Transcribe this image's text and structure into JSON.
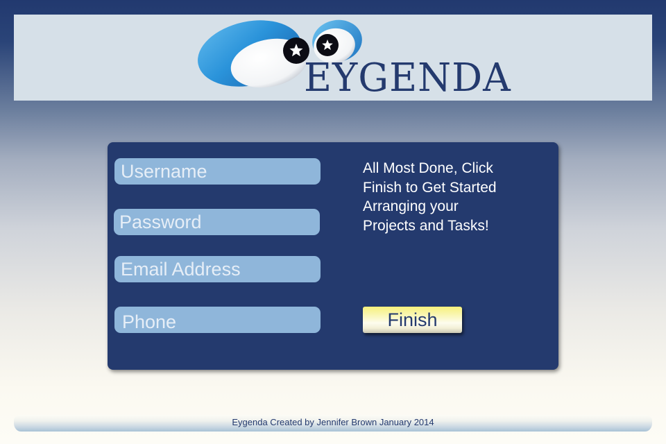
{
  "header": {
    "brand_name": "EYGENDA",
    "logo_icon": "eyes-logo-icon"
  },
  "signup": {
    "username_placeholder": "Username",
    "password_placeholder": "Password",
    "email_placeholder": "Email Address",
    "phone_placeholder": "Phone",
    "message": "All Most Done, Click Finish to Get Started Arranging your Projects and Tasks!",
    "finish_label": "Finish"
  },
  "footer": {
    "credit": "Eygenda Created by Jennifer Brown January 2014"
  },
  "colors": {
    "panel": "#243a6e",
    "field": "#8fb6da",
    "header_bg": "#d6e0e8",
    "brand_text": "#243a6e",
    "button_yellow": "#f6f07c"
  }
}
